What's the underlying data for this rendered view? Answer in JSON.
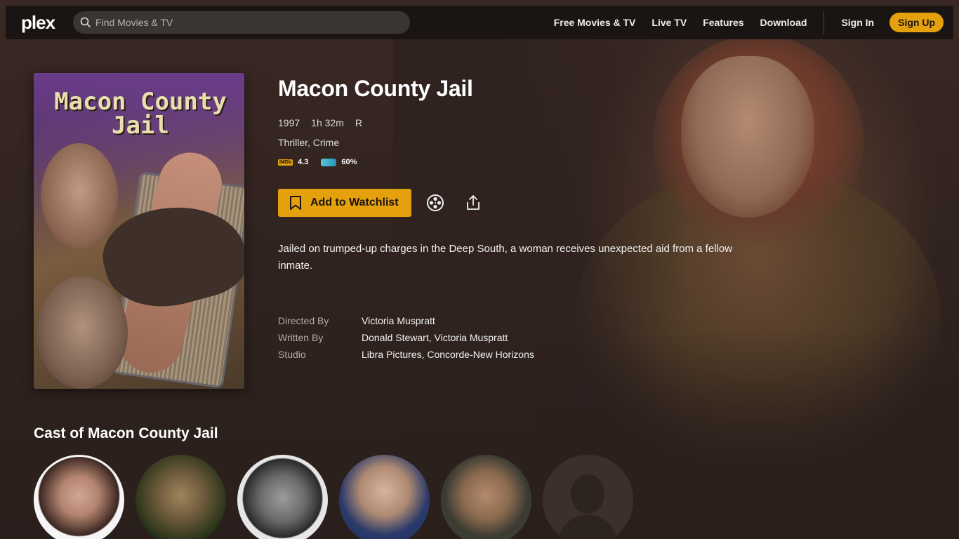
{
  "header": {
    "logo_text": "plex",
    "search_placeholder": "Find Movies & TV",
    "nav": [
      "Free Movies & TV",
      "Live TV",
      "Features",
      "Download"
    ],
    "sign_in": "Sign In",
    "sign_up": "Sign Up",
    "accent_color": "#e5a00d"
  },
  "movie": {
    "poster_title_line1": "Macon County",
    "poster_title_line2": "Jail",
    "title": "Macon County Jail",
    "year": "1997",
    "duration": "1h 32m",
    "rating": "R",
    "genres": "Thriller, Crime",
    "imdb_label": "IMDb",
    "imdb_score": "4.3",
    "rt_label": "TM",
    "rt_score": "60%",
    "watchlist_label": "Add to Watchlist",
    "summary": "Jailed on trumped-up charges in the Deep South, a woman receives unexpected aid from a fellow inmate.",
    "credits": [
      {
        "key": "Directed By",
        "value": "Victoria Muspratt"
      },
      {
        "key": "Written By",
        "value": "Donald Stewart, Victoria Muspratt"
      },
      {
        "key": "Studio",
        "value": "Libra Pictures, Concorde-New Horizons"
      }
    ]
  },
  "cast": {
    "heading": "Cast of Macon County Jail",
    "members": [
      {
        "icon": "cast-photo"
      },
      {
        "icon": "cast-photo"
      },
      {
        "icon": "cast-photo"
      },
      {
        "icon": "cast-photo"
      },
      {
        "icon": "cast-photo"
      },
      {
        "icon": "person-placeholder-icon"
      }
    ]
  }
}
